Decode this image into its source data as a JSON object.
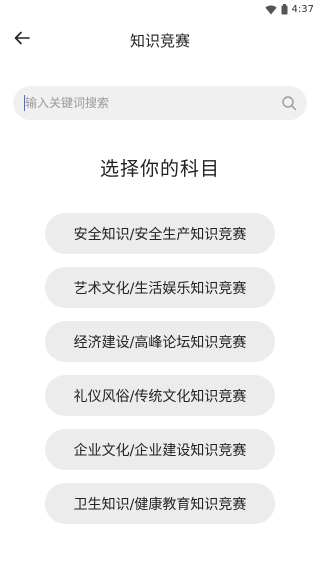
{
  "status_bar": {
    "time": "4:37",
    "icons": [
      "wifi-icon",
      "battery-icon"
    ]
  },
  "header": {
    "back_icon": "back-arrow-icon",
    "title": "知识竞赛"
  },
  "search": {
    "placeholder": "输入关键词搜索",
    "value": "",
    "icon": "search-icon"
  },
  "main": {
    "section_title": "选择你的科目",
    "subjects": [
      {
        "label": "安全知识/安全生产知识竞赛"
      },
      {
        "label": "艺术文化/生活娱乐知识竞赛"
      },
      {
        "label": "经济建设/高峰论坛知识竞赛"
      },
      {
        "label": "礼仪风俗/传统文化知识竞赛"
      },
      {
        "label": "企业文化/企业建设知识竞赛"
      },
      {
        "label": "卫生知识/健康教育知识竞赛"
      }
    ]
  },
  "colors": {
    "button_bg": "#ececec",
    "search_bg": "#f0f0f0",
    "text": "#222222",
    "placeholder": "#9a9a9a",
    "caret": "#3a6df0"
  }
}
